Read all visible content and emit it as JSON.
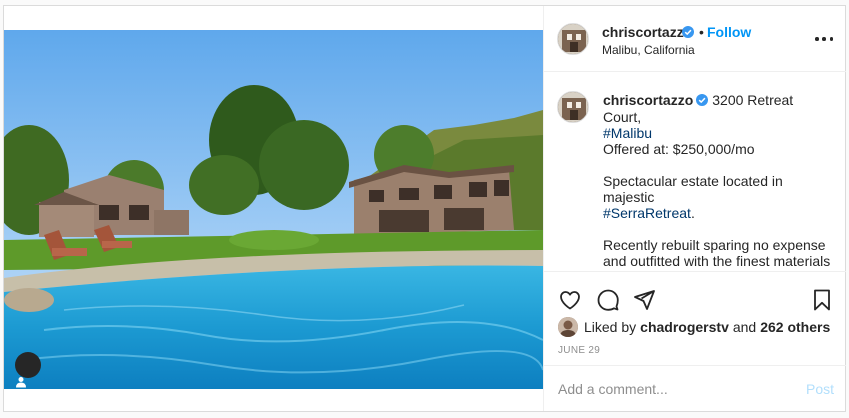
{
  "post": {
    "username": "chriscortazzo",
    "follow_label": "Follow",
    "separator": "•",
    "location": "Malibu, California",
    "caption": {
      "username": "chriscortazzo",
      "line1": "3200 Retreat Court,",
      "hashtag1": "#Malibu",
      "line2": "Offered at: $250,000/mo",
      "para2_text": "Spectacular estate located in majestic",
      "hashtag2": "#SerraRetreat",
      "para2_end": ".",
      "para3": "Recently rebuilt sparing no expense and outfitted with the finest materials and amenities, this warm and inviting home features vaulted two-story"
    },
    "likes": {
      "prefix": "Liked by",
      "user": "chadrogerstv",
      "conj": "and",
      "others": "262 others"
    },
    "date": "JUNE 29",
    "comment_placeholder": "Add a comment...",
    "post_label": "Post"
  },
  "icons": {
    "verified": "verified-badge-icon",
    "more": "more-options-icon",
    "like": "heart-icon",
    "comment": "comment-icon",
    "share": "share-icon",
    "save": "bookmark-icon",
    "user_tag": "user-tag-icon"
  },
  "colors": {
    "accent": "#0095f6",
    "hashtag": "#00376b",
    "muted": "#8e8e8e",
    "post_disabled": "#b2dffc",
    "verified": "#3897f0"
  }
}
